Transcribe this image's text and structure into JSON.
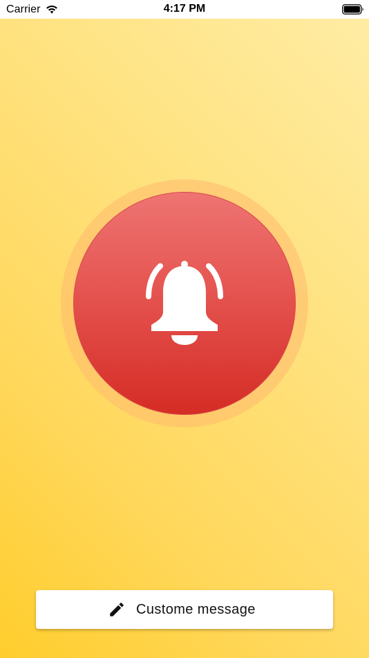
{
  "status_bar": {
    "carrier": "Carrier",
    "time": "4:17 PM",
    "wifi_icon": "wifi-icon",
    "battery_icon": "battery-full-icon"
  },
  "alarm": {
    "icon": "bell-ringing-icon",
    "button_color": "#e0443f",
    "halo_color": "#ffbd73"
  },
  "message_button": {
    "icon": "pencil-icon",
    "label": "Custome message"
  },
  "background": {
    "gradient_top": "#ffeda6",
    "gradient_bottom": "#ffcd2c"
  }
}
